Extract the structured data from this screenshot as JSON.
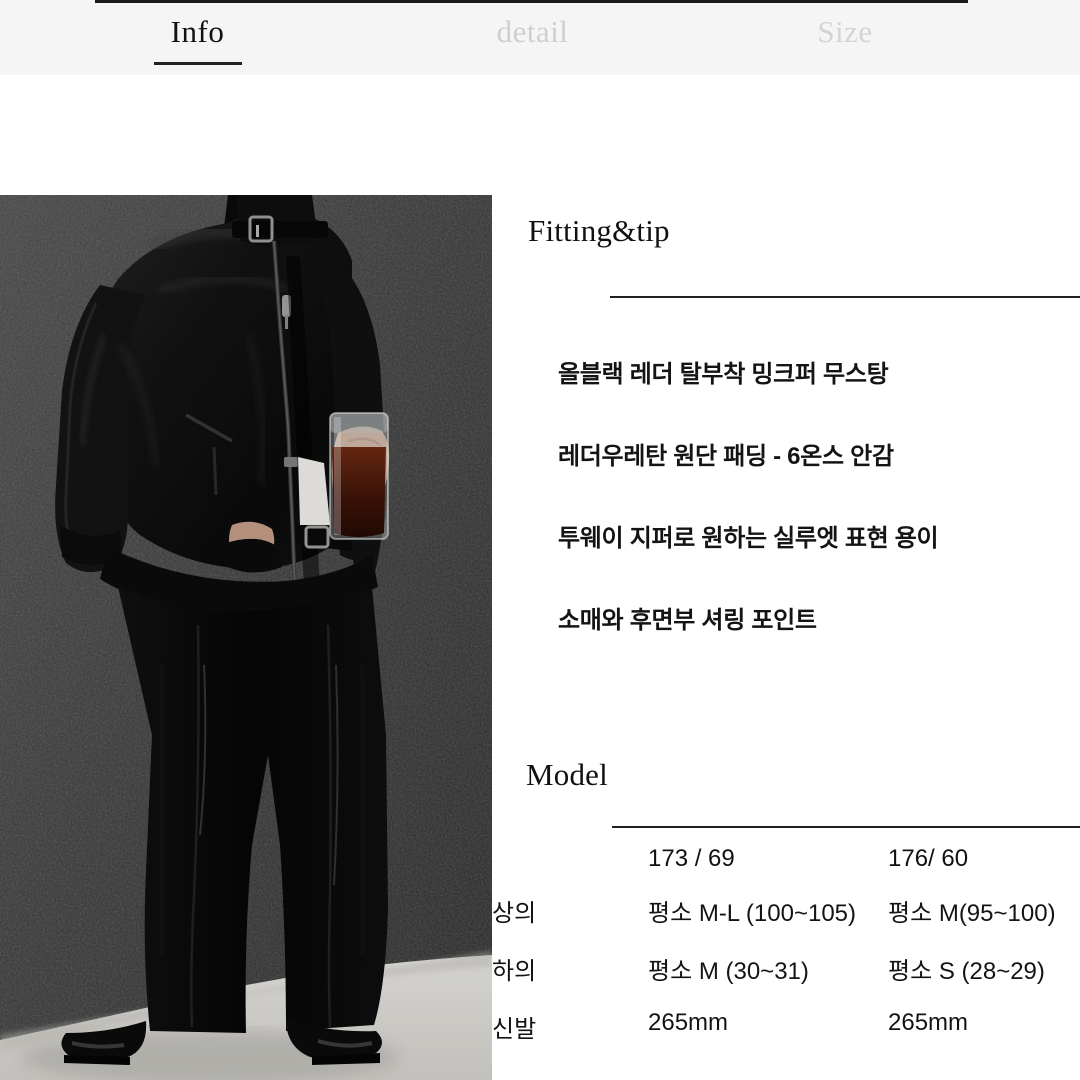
{
  "tabs": [
    {
      "id": "info",
      "label": "Info",
      "active": true
    },
    {
      "id": "detail",
      "label": "detail",
      "active": false
    },
    {
      "id": "size",
      "label": "Size",
      "active": false
    }
  ],
  "photo": {
    "alt_name": "model-wearing-black-leather-jacket",
    "description": "Male model in all-black leather bomber jacket and wide black trousers standing against a textured dark grey concrete wall, holding a glass of iced coffee, wearing glossy black shoes on a light floor",
    "colors": {
      "wall": "#3a3a3a",
      "wall_dark": "#2b2b2b",
      "floor": "#d8d6d2",
      "garment": "#0d0d0d",
      "drink": "#3d1408",
      "skin": "#caa996"
    }
  },
  "fitting": {
    "heading": "Fitting&tip",
    "lines": [
      "올블랙 레더 탈부착 밍크퍼 무스탕",
      "레더우레탄 원단 패딩 - 6온스 안감",
      "투웨이 지퍼로 원하는 실루엣 표현 용이",
      "소매와 후면부 셔링 포인트"
    ]
  },
  "model": {
    "heading": "Model",
    "columns": [
      "",
      "173 / 69",
      "176/ 60"
    ],
    "rows": [
      {
        "label": "상의",
        "a": "평소 M-L (100~105)",
        "b": "평소 M(95~100)"
      },
      {
        "label": "하의",
        "a": "평소 M (30~31)",
        "b": "평소 S (28~29)"
      },
      {
        "label": "신발",
        "a": "265mm",
        "b": "265mm"
      }
    ]
  },
  "colors": {
    "tabbar_bg": "#f5f5f6",
    "active_tab": "#111111",
    "inactive_tab": "#cfcfcf",
    "rule": "#1f1f1f",
    "text": "#141414"
  }
}
